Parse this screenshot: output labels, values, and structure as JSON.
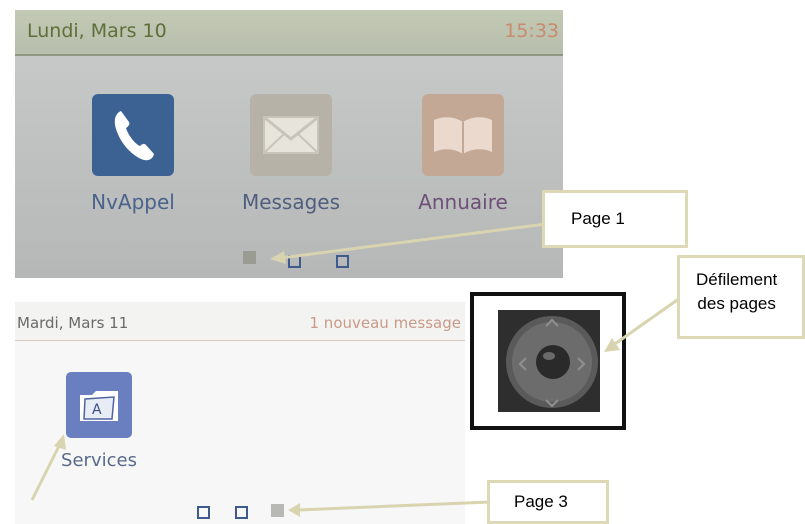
{
  "screen1": {
    "date": "Lundi, Mars 10",
    "time": "15:33",
    "apps": [
      {
        "label": "NvAppel",
        "icon": "phone-icon"
      },
      {
        "label": "Messages",
        "icon": "envelope-icon"
      },
      {
        "label": "Annuaire",
        "icon": "book-icon"
      }
    ],
    "page_indicator": {
      "current_page": 1,
      "total_pages": 3
    }
  },
  "screen2": {
    "date": "Mardi, Mars 11",
    "notification": "1 nouveau message",
    "apps": [
      {
        "label": "Services",
        "icon": "services-folder-icon",
        "icon_letter": "A"
      }
    ],
    "page_indicator": {
      "current_page": 3,
      "total_pages": 3
    }
  },
  "callouts": {
    "page1": "Page 1",
    "defilement_line1": "Défilement",
    "defilement_line2": "des pages",
    "page3": "Page 3"
  },
  "keypad": {
    "icon": "navigation-keypad-icon"
  },
  "colors": {
    "arrow": "#d8d4b0",
    "accent": "#3c6294"
  }
}
